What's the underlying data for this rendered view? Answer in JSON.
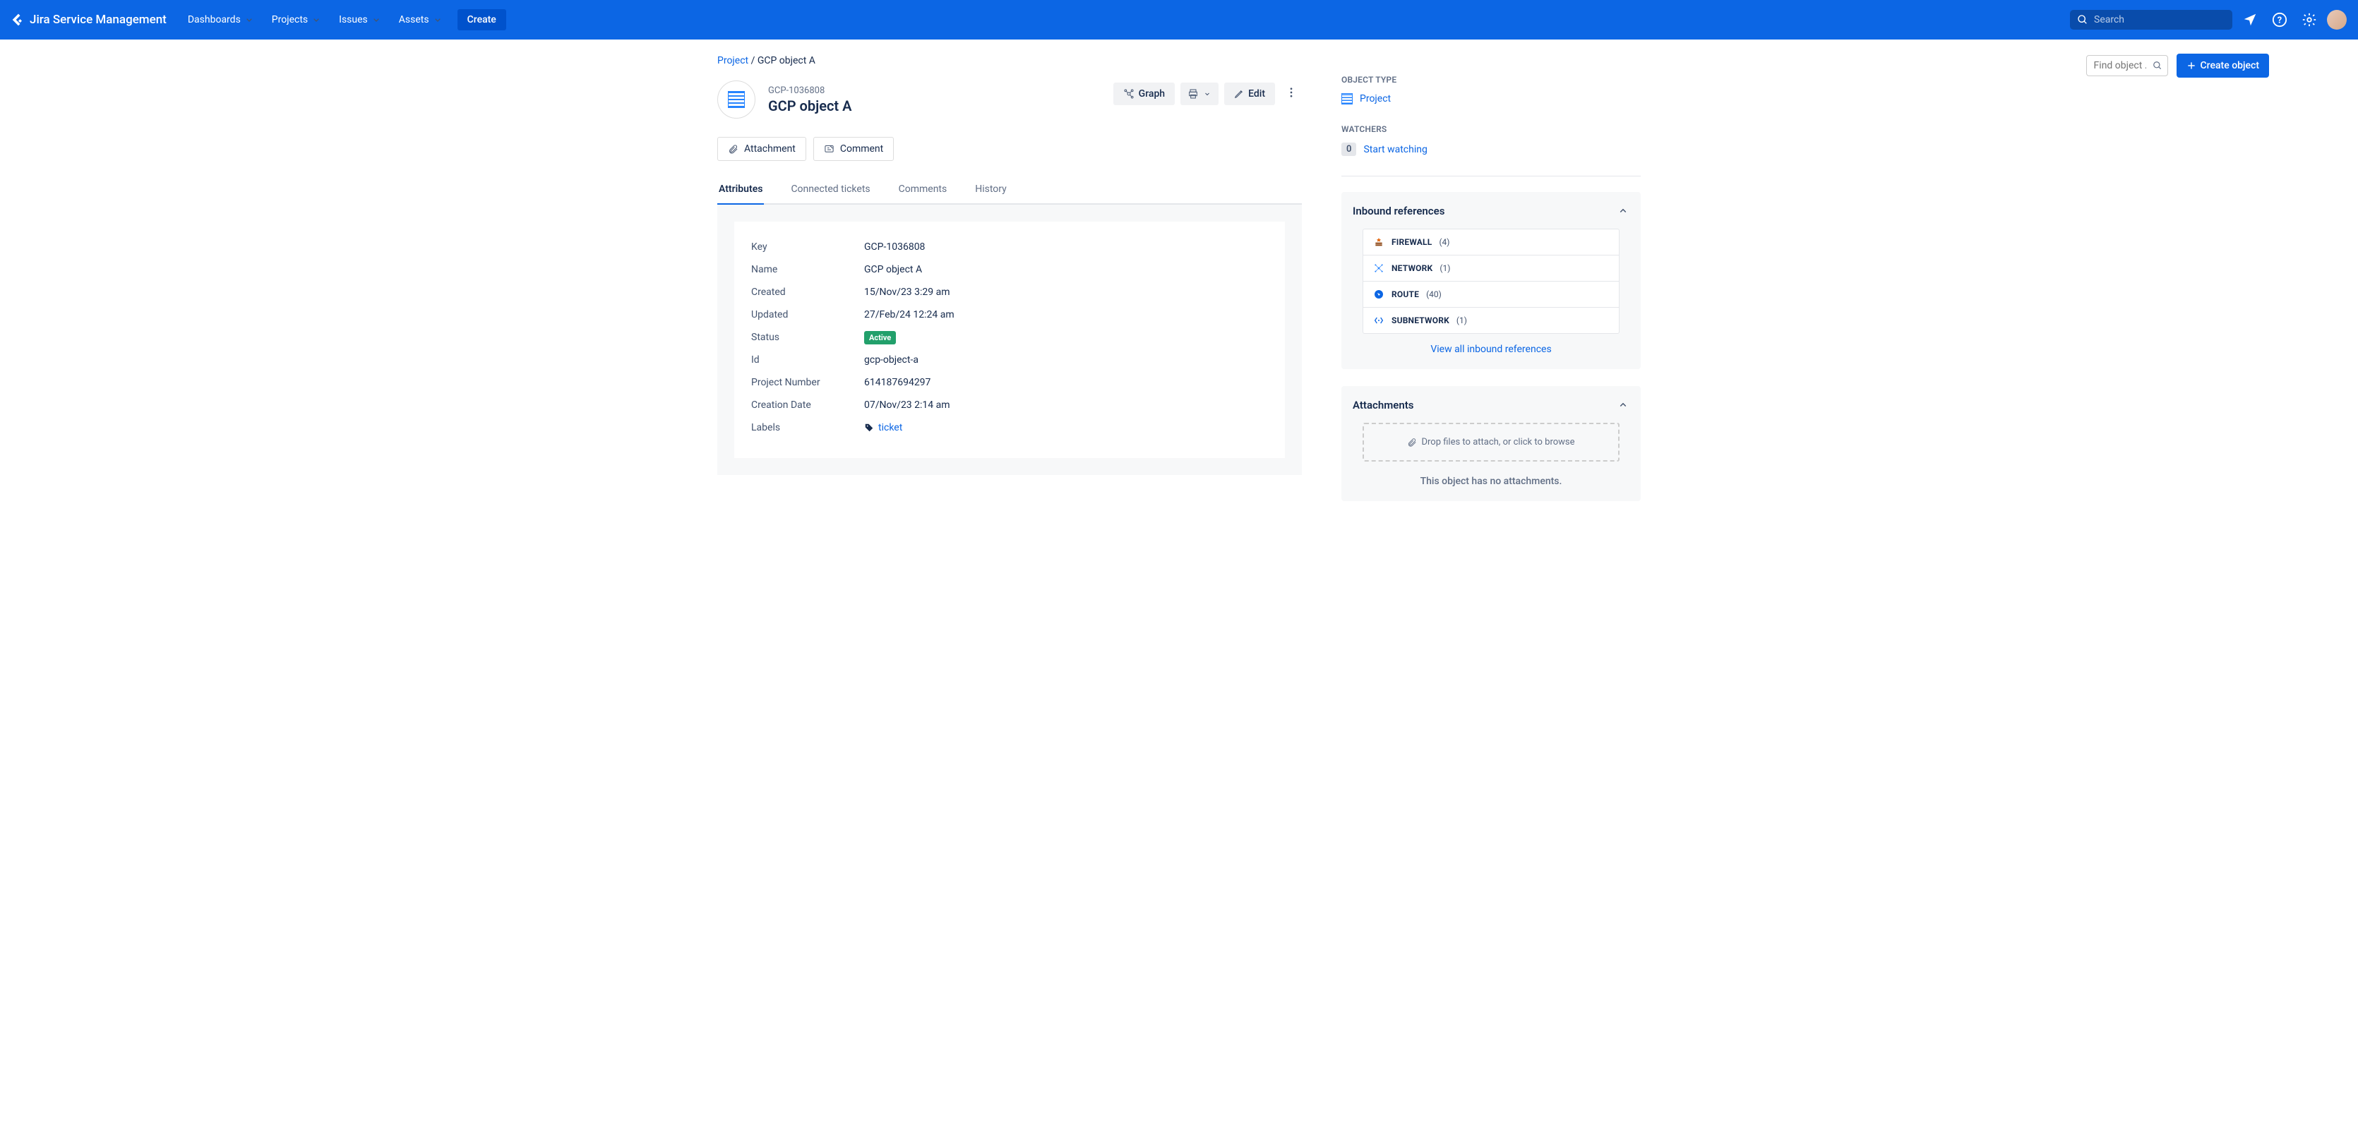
{
  "nav": {
    "brand": "Jira Service Management",
    "items": [
      "Dashboards",
      "Projects",
      "Issues",
      "Assets"
    ],
    "create": "Create",
    "search_placeholder": "Search"
  },
  "breadcrumb": {
    "project": "Project",
    "current": "GCP object A",
    "find_placeholder": "Find object …",
    "create_object": "Create object"
  },
  "object": {
    "key": "GCP-1036808",
    "name": "GCP object A"
  },
  "header_actions": {
    "graph": "Graph",
    "edit": "Edit"
  },
  "actions": {
    "attachment": "Attachment",
    "comment": "Comment"
  },
  "tabs": [
    "Attributes",
    "Connected tickets",
    "Comments",
    "History"
  ],
  "attributes": [
    {
      "label": "Key",
      "value": "GCP-1036808"
    },
    {
      "label": "Name",
      "value": "GCP object A"
    },
    {
      "label": "Created",
      "value": "15/Nov/23 3:29 am"
    },
    {
      "label": "Updated",
      "value": "27/Feb/24 12:24 am"
    },
    {
      "label": "Status",
      "value": "Active",
      "type": "status"
    },
    {
      "label": "Id",
      "value": "gcp-object-a"
    },
    {
      "label": "Project Number",
      "value": "614187694297"
    },
    {
      "label": "Creation Date",
      "value": "07/Nov/23 2:14 am"
    },
    {
      "label": "Labels",
      "value": "ticket",
      "type": "label"
    }
  ],
  "side": {
    "object_type_h": "OBJECT TYPE",
    "object_type": "Project",
    "watchers_h": "WATCHERS",
    "watch_count": "0",
    "start_watching": "Start watching",
    "inbound_h": "Inbound references",
    "inbound": [
      {
        "name": "FIREWALL",
        "count": "(4)",
        "icon": "firewall"
      },
      {
        "name": "NETWORK",
        "count": "(1)",
        "icon": "network"
      },
      {
        "name": "ROUTE",
        "count": "(40)",
        "icon": "route"
      },
      {
        "name": "SUBNETWORK",
        "count": "(1)",
        "icon": "subnetwork"
      }
    ],
    "view_all": "View all inbound references",
    "attachments_h": "Attachments",
    "dropzone": "Drop files to attach, or click to browse",
    "no_attachments": "This object has no attachments."
  }
}
